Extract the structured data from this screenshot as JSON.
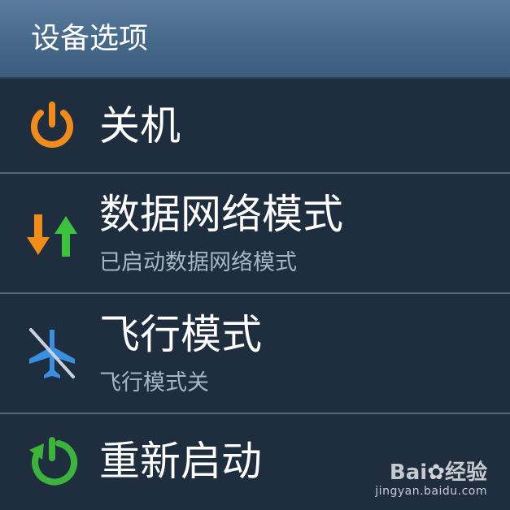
{
  "dialog": {
    "title": "设备选项",
    "items": [
      {
        "icon": "power-icon",
        "label": "关机"
      },
      {
        "icon": "data-network-icon",
        "label": "数据网络模式",
        "status": "已启动数据网络模式"
      },
      {
        "icon": "airplane-off-icon",
        "label": "飞行模式",
        "status": "飞行模式关"
      },
      {
        "icon": "restart-icon",
        "label": "重新启动"
      }
    ]
  },
  "watermark": {
    "brand": "Bai",
    "brand_suffix": "经验",
    "url": "jingyan.baidu.com"
  },
  "colors": {
    "header_gradient_top": "#5a7c9f",
    "header_gradient_bottom": "#3d5d7e",
    "list_background": "#1e2e3e",
    "divider": "#52677d",
    "power_orange": "#f08c1a",
    "arrow_orange": "#f08c1a",
    "arrow_green": "#3cc23c",
    "airplane_blue": "#3a8fe0",
    "restart_green": "#3cb43c"
  }
}
